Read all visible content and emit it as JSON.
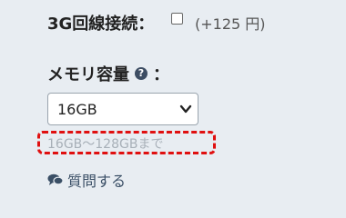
{
  "option_3g": {
    "label": "3G回線接続：",
    "checked": false,
    "price": "(+125 円)"
  },
  "memory": {
    "label": "メモリ容量",
    "colon": "：",
    "help_icon": "question-circle-icon",
    "selected": "16GB",
    "hint": "16GB〜128GBまで"
  },
  "ask": {
    "icon": "speech-bubbles-icon",
    "label": "質問する"
  },
  "colors": {
    "highlight": "#e01010",
    "background": "#e8edf2"
  }
}
